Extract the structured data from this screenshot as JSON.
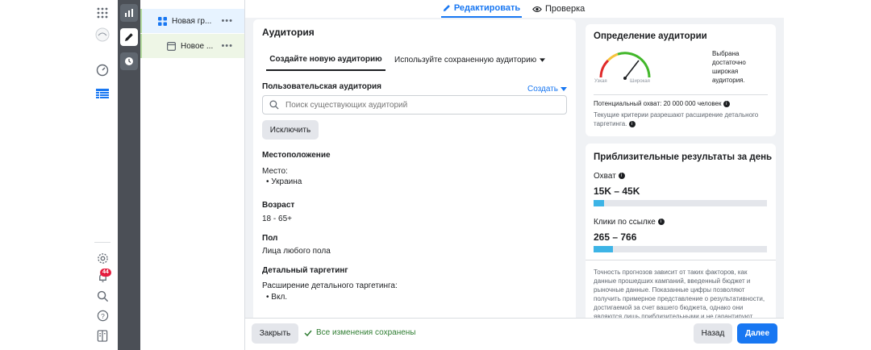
{
  "rail": {
    "badge_count": "44"
  },
  "tree": {
    "items": [
      {
        "label": "Новая гр..."
      },
      {
        "label": "Новое ..."
      }
    ]
  },
  "topbar": {
    "edit_tab": "Редактировать",
    "review_tab": "Проверка"
  },
  "audience": {
    "title": "Аудитория",
    "tab_new": "Создайте новую аудиторию",
    "tab_saved": "Используйте сохраненную аудиторию",
    "custom_label": "Пользовательская аудитория",
    "create_link": "Создать",
    "search_placeholder": "Поиск существующих аудиторий",
    "exclude_button": "Исключить",
    "location_heading": "Местоположение",
    "location_label": "Место:",
    "location_value": "Украина",
    "age_heading": "Возраст",
    "age_value": "18 - 65+",
    "gender_heading": "Пол",
    "gender_value": "Лица любого пола",
    "targeting_heading": "Детальный таргетинг",
    "targeting_label": "Расширение детального таргетинга:",
    "targeting_value": "Вкл."
  },
  "definition": {
    "title": "Определение аудитории",
    "gauge_narrow": "Узкая",
    "gauge_wide": "Широкая",
    "gauge_text": "Выбрана достаточно широкая аудитория.",
    "potential_reach": "Потенциальный охват: 20 000 000 человек",
    "criteria_note": "Текущие критерии разрешают расширение детального таргетинга."
  },
  "estimates": {
    "title": "Приблизительные результаты за день",
    "reach_label": "Охват",
    "reach_value": "15K – 45K",
    "reach_fill": 0.06,
    "clicks_label": "Клики по ссылке",
    "clicks_value": "265 – 766",
    "clicks_fill": 0.11,
    "disclaimer": "Точность прогнозов зависит от таких факторов, как данные прошедших кампаний, введенный бюджет и рыночные данные. Показанные цифры позволяют получить примерное представление о результативности, достигаемой за счет вашего бюджета, однако они являются лишь приблизительными и не гарантируют"
  },
  "footer": {
    "close_button": "Закрыть",
    "saved_text": "Все изменения сохранены",
    "back_button": "Назад",
    "next_button": "Далее"
  },
  "colors": {
    "accent": "#1877f2",
    "bar_fill": "#3db4e6",
    "saved_green": "#2f7d32"
  }
}
